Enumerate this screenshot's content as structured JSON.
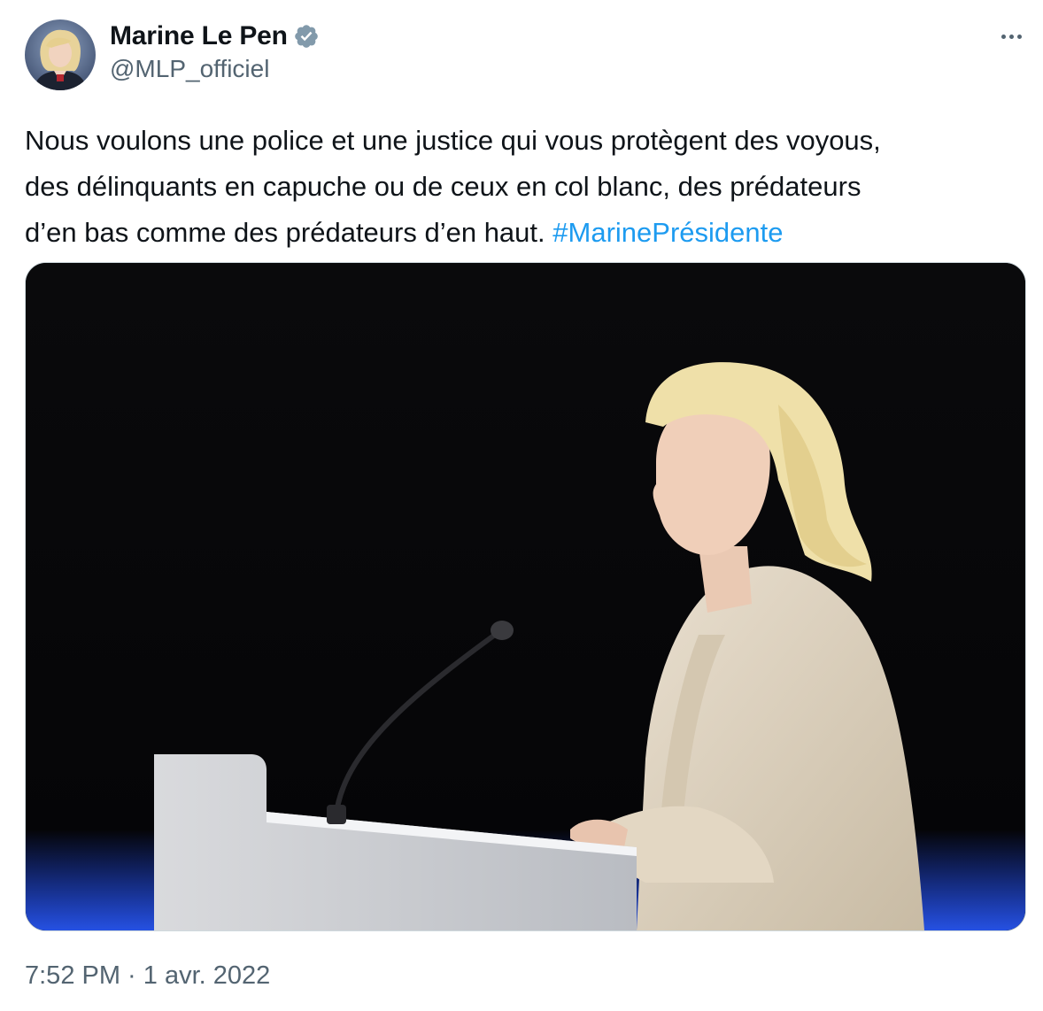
{
  "author": {
    "display_name": "Marine Le Pen",
    "handle": "@MLP_officiel",
    "verified": true,
    "avatar_icon": "profile-photo"
  },
  "more_icon": "more-options-icon",
  "tweet": {
    "text": "Nous voulons une police et une justice qui vous protègent des voyous,\ndes délinquants en capuche ou de ceux en col blanc, des prédateurs\nd’en bas comme des prédateurs d’en haut. ",
    "hashtag": "#MarinePrésidente"
  },
  "media": {
    "kind": "photo",
    "subject": "speaker-at-podium-photo"
  },
  "meta": {
    "timestamp": "7:52 PM · 1 avr. 2022"
  },
  "colors": {
    "text": "#0f1419",
    "secondary": "#536471",
    "link": "#1d9bf0",
    "verified": "#829aab",
    "border": "#cfd9de"
  }
}
